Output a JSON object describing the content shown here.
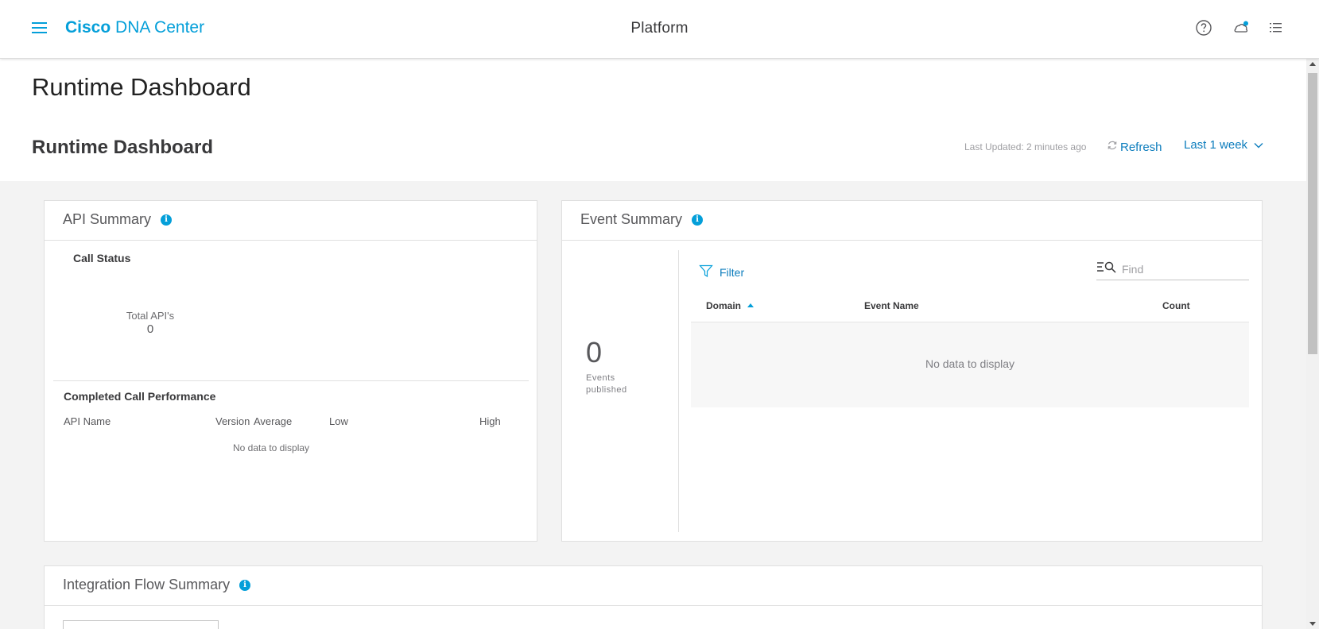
{
  "header": {
    "brand_bold": "Cisco",
    "brand_product": "DNA Center",
    "app_title": "Platform",
    "icons": [
      "menu-icon",
      "help-icon",
      "notifications-icon",
      "list-icon"
    ]
  },
  "page": {
    "title": "Runtime Dashboard",
    "section_title": "Runtime Dashboard",
    "last_updated": "Last Updated: 2 minutes ago",
    "refresh_label": "Refresh",
    "time_range": "Last 1 week"
  },
  "api_summary": {
    "title": "API Summary",
    "call_status_label": "Call Status",
    "total_label": "Total API's",
    "total_value": "0",
    "performance_title": "Completed Call Performance",
    "columns": [
      "API Name",
      "Version",
      "Average",
      "Low",
      "High"
    ],
    "empty_text": "No data to display"
  },
  "event_summary": {
    "title": "Event Summary",
    "events_count": "0",
    "events_label_1": "Events",
    "events_label_2": "published",
    "filter_label": "Filter",
    "find_placeholder": "Find",
    "columns": [
      "Domain",
      "Event Name",
      "Count"
    ],
    "empty_text": "No data to display"
  },
  "integration_flow": {
    "title": "Integration Flow Summary"
  },
  "colors": {
    "accent": "#049fd9",
    "link": "#0d7dbd",
    "background": "#f3f3f3"
  }
}
